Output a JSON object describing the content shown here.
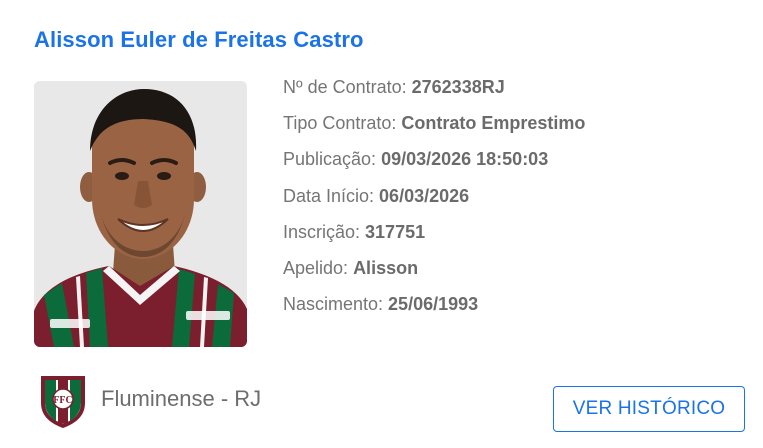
{
  "player": {
    "name": "Alisson Euler de Freitas Castro"
  },
  "details": [
    {
      "label": "Nº de Contrato: ",
      "value": "2762338RJ"
    },
    {
      "label": "Tipo Contrato: ",
      "value": "Contrato Emprestimo"
    },
    {
      "label": "Publicação: ",
      "value": "09/03/2026 18:50:03"
    },
    {
      "label": "Data Início: ",
      "value": "06/03/2026"
    },
    {
      "label": "Inscrição: ",
      "value": "317751"
    },
    {
      "label": "Apelido: ",
      "value": "Alisson"
    },
    {
      "label": "Nascimento: ",
      "value": "25/06/1993"
    }
  ],
  "club": {
    "name": "Fluminense - RJ",
    "crest_text": "FFC",
    "colors": {
      "maroon": "#7b1e2e",
      "green": "#0b6b3a",
      "white": "#ffffff"
    }
  },
  "actions": {
    "history_label": "VER HISTÓRICO"
  },
  "theme": {
    "accent": "#1a73e8"
  }
}
